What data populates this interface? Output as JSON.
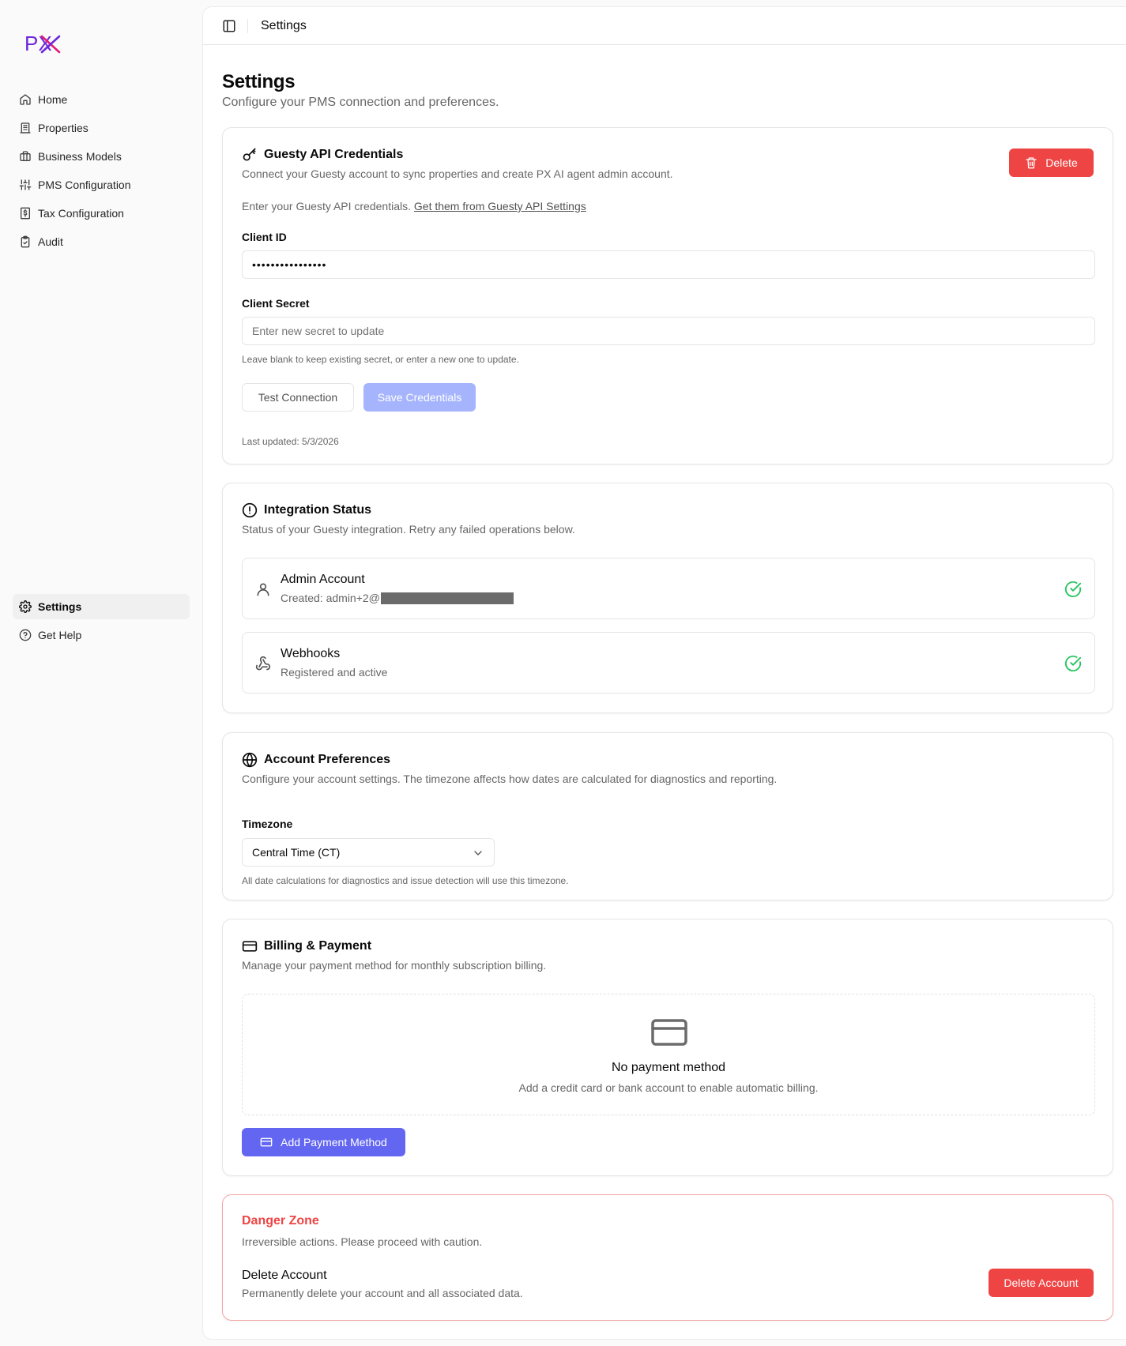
{
  "brand": {
    "logo_text": "PX",
    "accent": "#6d28d9",
    "accent2": "#e11d74"
  },
  "sidebar": {
    "items": [
      {
        "label": "Home",
        "icon": "home-icon"
      },
      {
        "label": "Properties",
        "icon": "building-icon"
      },
      {
        "label": "Business Models",
        "icon": "briefcase-icon"
      },
      {
        "label": "PMS Configuration",
        "icon": "sliders-icon"
      },
      {
        "label": "Tax Configuration",
        "icon": "receipt-icon"
      },
      {
        "label": "Audit",
        "icon": "clipboard-icon"
      }
    ],
    "bottom_items": [
      {
        "label": "Settings",
        "icon": "gear-icon",
        "active": true
      },
      {
        "label": "Get Help",
        "icon": "help-circle-icon"
      }
    ]
  },
  "topbar": {
    "breadcrumb": "Settings"
  },
  "page": {
    "title": "Settings",
    "subtitle": "Configure your PMS connection and preferences."
  },
  "guesty": {
    "title": "Guesty API Credentials",
    "description": "Connect your Guesty account to sync properties and create PX AI agent admin account.",
    "delete_label": "Delete",
    "intro_text": "Enter your Guesty API credentials.",
    "intro_link": "Get them from Guesty API Settings",
    "client_id_label": "Client ID",
    "client_id_value": "••••••••••••••••",
    "client_secret_label": "Client Secret",
    "client_secret_placeholder": "Enter new secret to update",
    "client_secret_hint": "Leave blank to keep existing secret, or enter a new one to update.",
    "test_label": "Test Connection",
    "save_label": "Save Credentials",
    "last_updated": "Last updated: 5/3/2026"
  },
  "integration": {
    "title": "Integration Status",
    "description": "Status of your Guesty integration. Retry any failed operations below.",
    "admin": {
      "title": "Admin Account",
      "subtitle": "Created: admin+2@"
    },
    "webhooks": {
      "title": "Webhooks",
      "subtitle": "Registered and active"
    },
    "success_color": "#22c55e"
  },
  "preferences": {
    "title": "Account Preferences",
    "description": "Configure your account settings. The timezone affects how dates are calculated for diagnostics and reporting.",
    "timezone_label": "Timezone",
    "timezone_value": "Central Time (CT)",
    "timezone_hint": "All date calculations for diagnostics and issue detection will use this timezone."
  },
  "billing": {
    "title": "Billing & Payment",
    "description": "Manage your payment method for monthly subscription billing.",
    "empty_title": "No payment method",
    "empty_subtitle": "Add a credit card or bank account to enable automatic billing.",
    "add_label": "Add Payment Method"
  },
  "danger": {
    "title": "Danger Zone",
    "description": "Irreversible actions. Please proceed with caution.",
    "item_title": "Delete Account",
    "item_subtitle": "Permanently delete your account and all associated data.",
    "button_label": "Delete Account",
    "color": "#ef4444"
  }
}
